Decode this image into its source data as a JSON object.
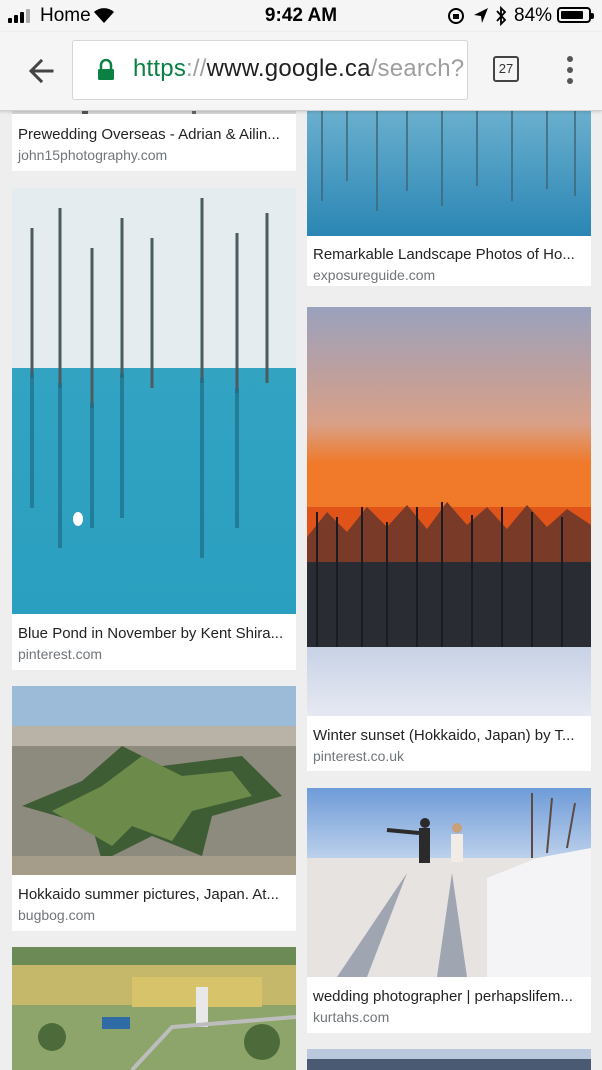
{
  "status": {
    "carrier": "Home",
    "time": "9:42 AM",
    "battery_pct": "84%",
    "battery_level": 0.84
  },
  "browser": {
    "url_scheme": "https",
    "url_sep": "://",
    "url_host": "www.google.ca",
    "url_path": "/search?",
    "tab_count": "27"
  },
  "results": {
    "r1": {
      "title": "Prewedding Overseas - Adrian & Ailin...",
      "source": "john15photography.com"
    },
    "r2": {
      "title": "Remarkable Landscape Photos of Ho...",
      "source": "exposureguide.com"
    },
    "r3": {
      "title": "Blue Pond in November by Kent Shira...",
      "source": "pinterest.com"
    },
    "r4": {
      "title": "Winter sunset (Hokkaido, Japan) by T...",
      "source": "pinterest.co.uk"
    },
    "r5": {
      "title": "Hokkaido summer pictures, Japan. At...",
      "source": "bugbog.com"
    },
    "r6": {
      "title": "wedding photographer | perhapslifem...",
      "source": "kurtahs.com"
    }
  },
  "colors": {
    "secure_green": "#0b8043",
    "pond_blue": "#2a9fbf",
    "sunset_orange": "#f07a2a"
  }
}
